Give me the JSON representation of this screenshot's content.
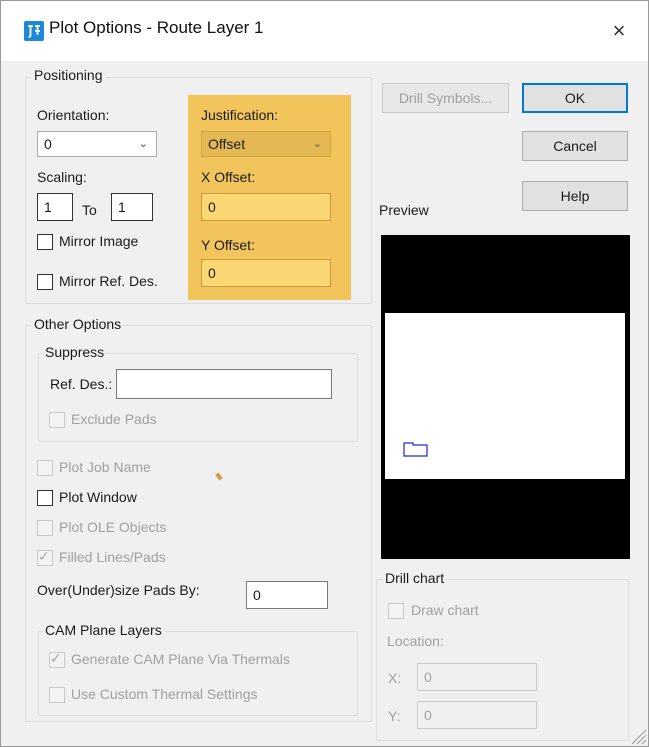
{
  "window": {
    "title": "Plot Options - Route Layer 1",
    "icon": "app-icon",
    "close_icon": "×"
  },
  "positioning": {
    "legend": "Positioning",
    "orientation_label": "Orientation:",
    "orientation_value": "0",
    "scaling_label": "Scaling:",
    "scale_from": "1",
    "to_label": "To",
    "scale_to": "1",
    "mirror_image_label": "Mirror Image",
    "mirror_image_checked": false,
    "mirror_refdes_label": "Mirror Ref. Des.",
    "mirror_refdes_checked": false,
    "justification_label": "Justification:",
    "justification_value": "Offset",
    "x_offset_label": "X Offset:",
    "x_offset_value": "0",
    "y_offset_label": "Y Offset:",
    "y_offset_value": "0",
    "highlight_color": "#f2c55c"
  },
  "buttons": {
    "drill_symbols": "Drill Symbols...",
    "ok": "OK",
    "cancel": "Cancel",
    "help": "Help"
  },
  "preview": {
    "label": "Preview"
  },
  "other_options": {
    "legend": "Other Options",
    "suppress_legend": "Suppress",
    "refdes_label": "Ref. Des.:",
    "refdes_value": "",
    "exclude_pads_label": "Exclude Pads",
    "plot_job_name_label": "Plot Job Name",
    "plot_window_label": "Plot Window",
    "plot_ole_label": "Plot OLE Objects",
    "filled_lines_label": "Filled Lines/Pads",
    "filled_lines_checked": true,
    "oversize_label": "Over(Under)size Pads By:",
    "oversize_value": "0"
  },
  "cam_plane": {
    "legend": "CAM Plane Layers",
    "generate_label": "Generate CAM Plane Via Thermals",
    "generate_checked": true,
    "custom_label": "Use Custom Thermal Settings",
    "custom_checked": false
  },
  "drill_chart": {
    "legend": "Drill chart",
    "draw_chart_label": "Draw chart",
    "location_label": "Location:",
    "x_label": "X:",
    "x_value": "0",
    "y_label": "Y:",
    "y_value": "0"
  },
  "colors": {
    "accent": "#0078d7",
    "app_icon": "#1e88d8",
    "preview_background": "#000000"
  }
}
